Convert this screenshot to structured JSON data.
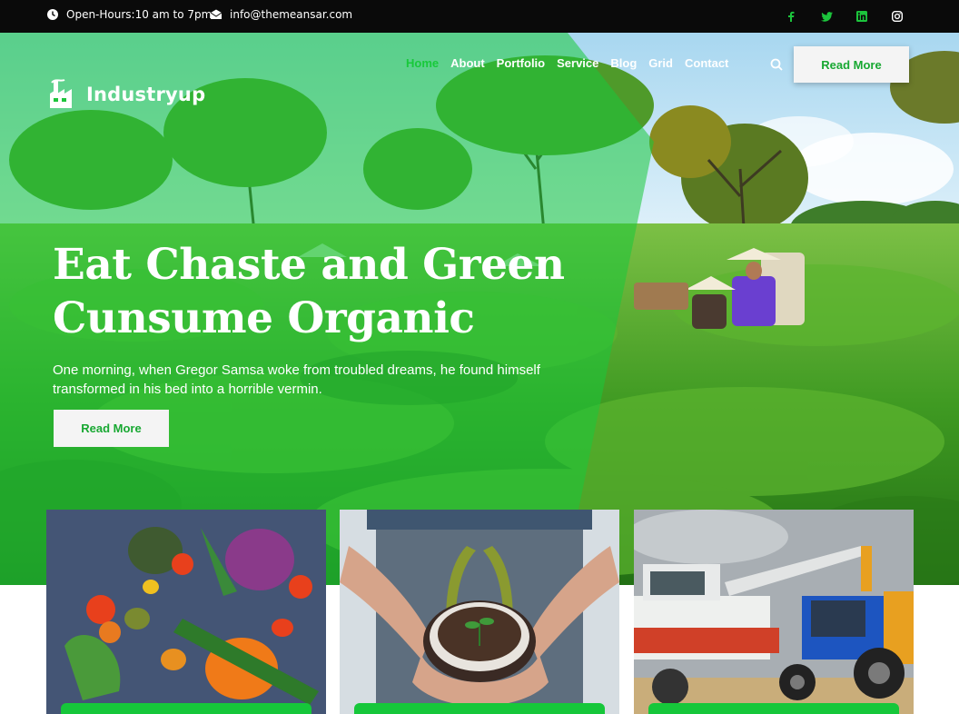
{
  "topbar": {
    "hours": "Open-Hours:10 am to 7pm",
    "email": "info@themeansar.com",
    "hours_icon": "clock-icon",
    "email_icon": "envelope-icon",
    "social": [
      "facebook-icon",
      "twitter-icon",
      "linkedin-icon",
      "instagram-icon"
    ]
  },
  "header": {
    "logo": "Industryup",
    "nav": [
      "Home",
      "About",
      "Portfolio",
      "Service",
      "Blog",
      "Grid",
      "Contact"
    ],
    "search_icon": "search-icon",
    "cta": "Read More"
  },
  "hero": {
    "title_line1": "Eat Chaste and Green",
    "title_line2": "Cunsume Organic",
    "subtitle": "One morning, when Gregor Samsa woke from troubled dreams, he found himself transformed in his bed into a horrible vermin.",
    "button": "Read More"
  },
  "cards": [
    {
      "image": "vegetables-photo"
    },
    {
      "image": "hands-holding-seedling-photo"
    },
    {
      "image": "harvester-and-tractor-photo"
    }
  ],
  "colors": {
    "accent": "#16c73a",
    "topbar": "#0a0a0a",
    "overlay": "#18c93a"
  }
}
